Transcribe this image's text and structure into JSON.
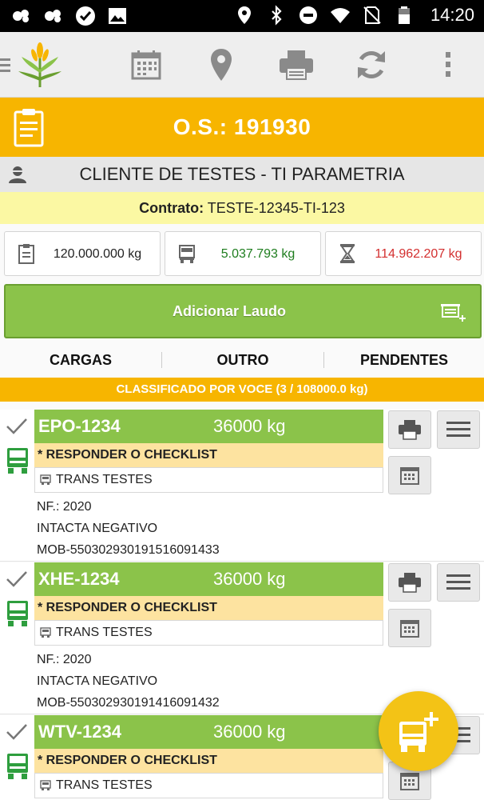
{
  "status_bar": {
    "time": "14:20",
    "left_icons": [
      "messenger-icon",
      "messenger-icon",
      "check-circle-icon",
      "image-icon"
    ],
    "right_icons": [
      "location-icon",
      "bluetooth-icon",
      "do-not-disturb-icon",
      "wifi-icon",
      "no-sim-icon",
      "battery-icon"
    ]
  },
  "toolbar": {
    "icons": [
      "menu-icon",
      "app-logo",
      "calendar-icon",
      "map-pin-icon",
      "printer-icon",
      "refresh-icon",
      "more-vert-icon"
    ]
  },
  "os_header": {
    "title": "O.S.: 191930",
    "color": "#f7b500"
  },
  "client": {
    "name": "CLIENTE DE TESTES - TI PARAMETRIA"
  },
  "contract": {
    "label": "Contrato:",
    "value": "TESTE-12345-TI-123"
  },
  "stats": [
    {
      "icon": "clipboard-icon",
      "value": "120.000.000 kg",
      "color": "#222222"
    },
    {
      "icon": "truck-icon",
      "value": "5.037.793 kg",
      "color": "#1e7d1e"
    },
    {
      "icon": "hourglass-icon",
      "value": "114.962.207 kg",
      "color": "#d32f2f"
    }
  ],
  "add_laudo": {
    "label": "Adicionar Laudo",
    "color": "#8bc34a"
  },
  "tabs": [
    "CARGAS",
    "OUTRO",
    "PENDENTES"
  ],
  "section": {
    "label": "CLASSIFICADO POR VOCE (3 / 108000.0 kg)"
  },
  "cards": [
    {
      "plate": "EPO-1234",
      "weight": "36000 kg",
      "checklist": "* RESPONDER O CHECKLIST",
      "transport": "TRANS TESTES",
      "nf": "NF.: 2020",
      "status": "INTACTA NEGATIVO",
      "code": "MOB-550302930191516091433"
    },
    {
      "plate": "XHE-1234",
      "weight": "36000 kg",
      "checklist": "* RESPONDER O CHECKLIST",
      "transport": "TRANS TESTES",
      "nf": "NF.: 2020",
      "status": "INTACTA NEGATIVO",
      "code": "MOB-550302930191416091432"
    },
    {
      "plate": "WTV-1234",
      "weight": "36000 kg",
      "checklist": "* RESPONDER O CHECKLIST",
      "transport": "TRANS TESTES",
      "nf": "",
      "status": "",
      "code": ""
    }
  ],
  "fab": {
    "icon": "add-truck-icon",
    "color": "#f3c316"
  }
}
